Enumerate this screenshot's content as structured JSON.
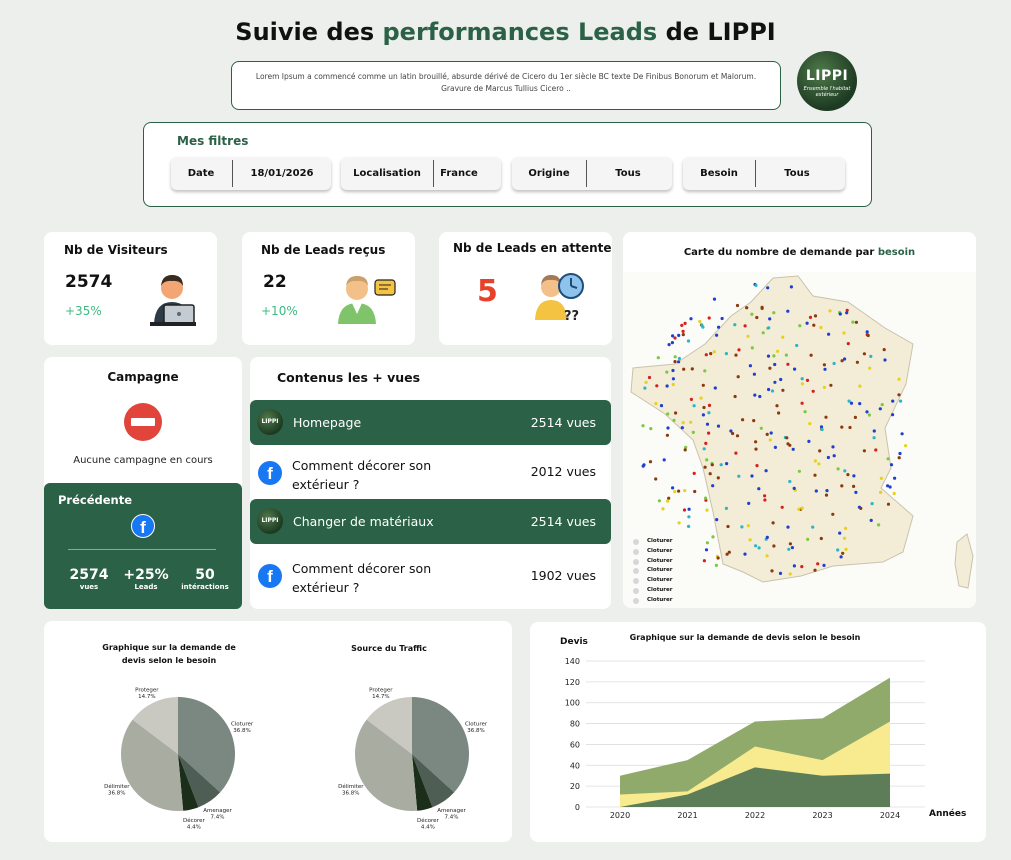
{
  "header": {
    "title_part1": "Suivie des ",
    "title_part2": "performances Leads",
    "title_part3": " de LIPPI",
    "description": "Lorem Ipsum a commencé comme un latin brouillé, absurde dérivé de Cicero du 1er siècle BC texte De Finibus Bonorum et Malorum. Gravure de Marcus Tullius Cicero ..",
    "logo_text": "LIPPI",
    "logo_tagline": "Ensemble l'habitat extérieur"
  },
  "filters": {
    "label": "Mes filtres",
    "items": [
      {
        "key": "Date",
        "value": "18/01/2026"
      },
      {
        "key": "Localisation",
        "value": "France"
      },
      {
        "key": "Origine",
        "value": "Tous"
      },
      {
        "key": "Besoin",
        "value": "Tous"
      }
    ]
  },
  "kpis": {
    "visitors": {
      "title": "Nb de Visiteurs",
      "value": "2574",
      "delta": "+35%"
    },
    "leads": {
      "title": "Nb de Leads reçus",
      "value": "22",
      "delta": "+10%"
    },
    "pending": {
      "title": "Nb de Leads en attente",
      "value": "5",
      "icon_text": "??"
    }
  },
  "campaign": {
    "title": "Campagne",
    "status": "Aucune campagne en cours",
    "previous": {
      "title": "Précédente",
      "stats": [
        {
          "value": "2574",
          "label": "vues"
        },
        {
          "value": "+25%",
          "label": "Leads"
        },
        {
          "value": "50",
          "label": "intéractions"
        }
      ]
    }
  },
  "contents": {
    "title": "Contenus les  + vues",
    "logo_text": "LIPPI",
    "items": [
      {
        "label": "Homepage",
        "views": "2514 vues",
        "source": "lippi"
      },
      {
        "label": "Comment décorer son extérieur ?",
        "views": "2012 vues",
        "source": "facebook"
      },
      {
        "label": "Changer de matériaux",
        "views": "2514 vues",
        "source": "lippi"
      },
      {
        "label": "Comment décorer son extérieur ?",
        "views": "1902 vues",
        "source": "facebook"
      }
    ]
  },
  "map": {
    "title_part1": "Carte du nombre de demande par ",
    "title_part2": "besoin",
    "legend": [
      "Cloturer",
      "Cloturer",
      "Cloturer",
      "Cloturer",
      "Cloturer",
      "Cloturer",
      "Cloturer"
    ]
  },
  "chart_data": [
    {
      "type": "pie",
      "title": "Graphique sur la demande de devis selon le besoin",
      "labels": [
        "Cloturer",
        "Amenager",
        "Décorer",
        "Délimiter",
        "Proteger"
      ],
      "values": [
        36.8,
        7.4,
        4.4,
        36.8,
        14.7
      ],
      "value_labels": [
        "36.8%",
        "7.4%",
        "4.4%",
        "36.8%",
        "14.7%"
      ],
      "colors": [
        "#7b8781",
        "#4e5e55",
        "#1a2e19",
        "#a8aca1",
        "#c9c9c1"
      ]
    },
    {
      "type": "pie",
      "title": "Source du Traffic",
      "labels": [
        "Cloturer",
        "Amenager",
        "Décorer",
        "Délimiter",
        "Proteger"
      ],
      "values": [
        36.8,
        7.4,
        4.4,
        36.8,
        14.7
      ],
      "value_labels": [
        "36.8%",
        "7.4%",
        "4.4%",
        "36.8%",
        "14.7%"
      ],
      "colors": [
        "#7b8781",
        "#4e5e55",
        "#1a2e19",
        "#a8aca1",
        "#c9c9c1"
      ]
    },
    {
      "type": "area",
      "title": "Graphique sur la demande de devis selon le besoin",
      "xlabel": "Années",
      "ylabel": "Devis",
      "categories": [
        "2020",
        "2021",
        "2022",
        "2023",
        "2024"
      ],
      "ylim": [
        0,
        140
      ],
      "yticks": [
        0,
        20,
        40,
        60,
        80,
        100,
        120,
        140
      ],
      "grid": true,
      "series": [
        {
          "values": [
            30,
            45,
            82,
            85,
            124
          ],
          "color": "#8faa6b"
        },
        {
          "values": [
            12,
            15,
            58,
            45,
            82
          ],
          "color": "#f7ea8f"
        },
        {
          "values": [
            0,
            12,
            38,
            30,
            32
          ],
          "color": "#5d7d59"
        }
      ]
    }
  ]
}
